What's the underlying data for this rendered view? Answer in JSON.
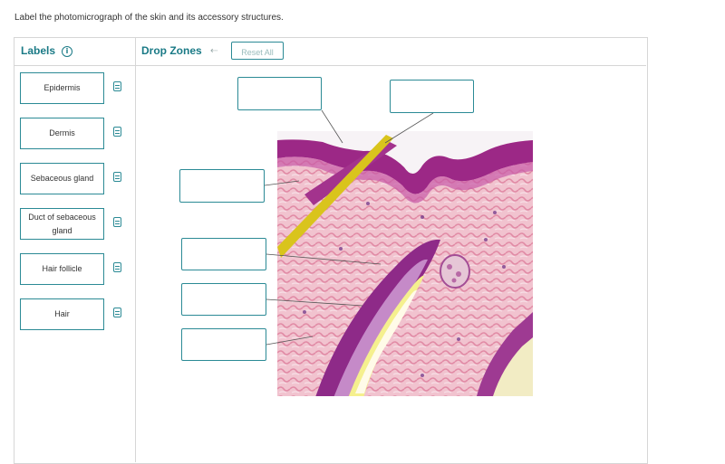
{
  "instruction": "Label the photomicrograph of the skin and its accessory structures.",
  "labels_panel": {
    "title": "Labels",
    "info_icon": "info-icon",
    "items": [
      {
        "label": "Epidermis"
      },
      {
        "label": "Dermis"
      },
      {
        "label": "Sebaceous gland"
      },
      {
        "label": "Duct of sebaceous gland"
      },
      {
        "label": "Hair follicle"
      },
      {
        "label": "Hair"
      }
    ]
  },
  "drop_zones_panel": {
    "title": "Drop Zones",
    "undo_icon": "undo-icon",
    "reset_label": "Reset All"
  },
  "colors": {
    "accent": "#1a7a86",
    "border": "#2b8a95",
    "tissue_pink": "#e8a2b8",
    "epidermis_purple": "#9a2a86",
    "hair_yellow": "#d8c21a"
  }
}
